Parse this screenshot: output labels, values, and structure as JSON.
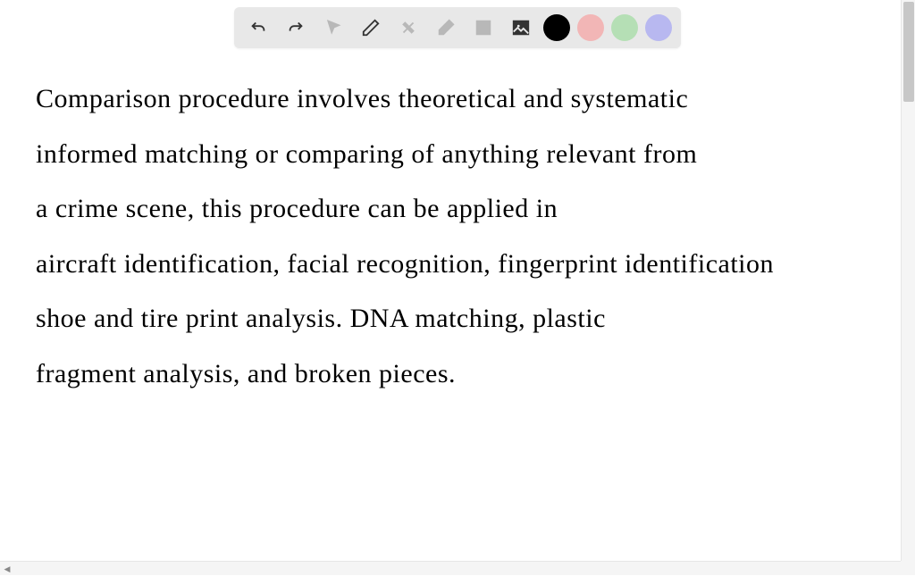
{
  "toolbar": {
    "icons": {
      "undo": "undo-icon",
      "redo": "redo-icon",
      "pointer": "pointer-icon",
      "pencil": "pencil-icon",
      "tools": "tools-icon",
      "eraser": "eraser-icon",
      "text": "text-icon",
      "image": "image-icon"
    },
    "colors": {
      "black": "#000000",
      "pink": "#f2b6b6",
      "green": "#b5dfb5",
      "purple": "#b8b8f0"
    }
  },
  "content": {
    "line1": "Comparison procedure involves theoretical and systematic",
    "line2": "informed matching or comparing of anything relevant from",
    "line3": "a crime scene, this procedure can be applied in",
    "line4": "aircraft identification, facial recognition, fingerprint identification",
    "line5": "shoe and tire print analysis. DNA matching, plastic",
    "line6": "fragment analysis, and broken pieces."
  }
}
